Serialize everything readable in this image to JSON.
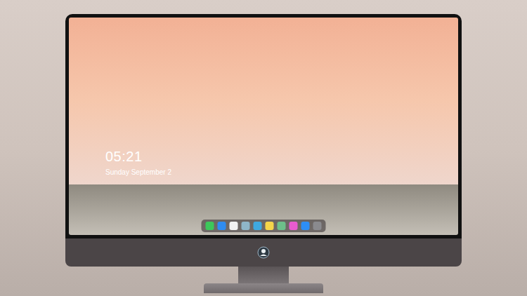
{
  "lock_screen": {
    "time": "05:21",
    "date": "Sunday September 2"
  },
  "dock": {
    "items": [
      {
        "color": "#3cc85a"
      },
      {
        "color": "#2f8cf0"
      },
      {
        "color": "#f2f2f2"
      },
      {
        "color": "#8fb6c9"
      },
      {
        "color": "#3fa9e0"
      },
      {
        "color": "#f5d54a"
      },
      {
        "color": "#6dbf8a"
      },
      {
        "color": "#e85bd0"
      },
      {
        "color": "#2d8ef5"
      },
      {
        "color": "#8a8a8e"
      }
    ]
  }
}
